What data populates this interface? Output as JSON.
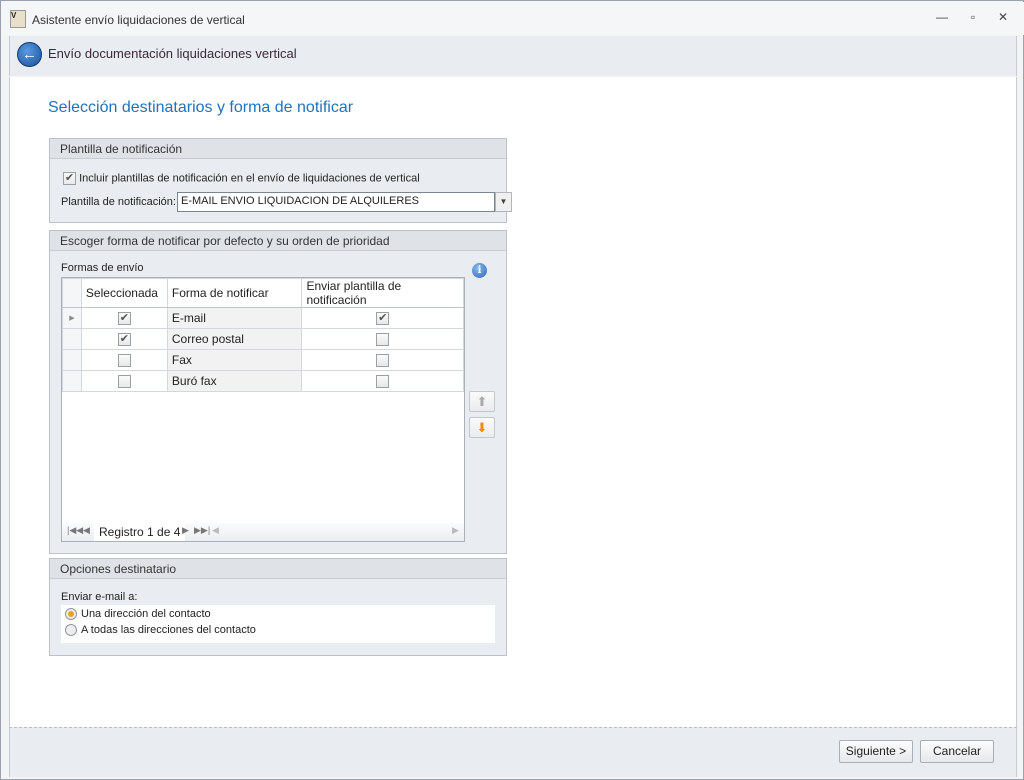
{
  "window": {
    "title": "Asistente envío liquidaciones de vertical",
    "minimize": "—",
    "restore": "▫",
    "close": "✕"
  },
  "header": {
    "title": "Envío documentación liquidaciones vertical"
  },
  "page": {
    "title": "Selección destinatarios y forma de notificar"
  },
  "plantilla": {
    "group_title": "Plantilla de notificación",
    "include_label": "Incluir plantillas de notificación en el envío de liquidaciones de vertical",
    "include_checked": true,
    "template_label": "Plantilla de notificación:",
    "template_value": "E-MAIL ENVIO LIQUIDACION DE ALQUILERES"
  },
  "formas": {
    "group_title": "Escoger forma de notificar por defecto y su orden de prioridad",
    "grid_label": "Formas de envío",
    "columns": [
      "Seleccionada",
      "Forma de notificar",
      "Enviar plantilla de notificación"
    ],
    "rows": [
      {
        "selected": true,
        "name": "E-mail",
        "send_template": true
      },
      {
        "selected": true,
        "name": "Correo postal",
        "send_template": false
      },
      {
        "selected": false,
        "name": "Fax",
        "send_template": false
      },
      {
        "selected": false,
        "name": "Buró fax",
        "send_template": false
      }
    ],
    "navigator": "Registro 1 de 4"
  },
  "destinatario": {
    "group_title": "Opciones destinatario",
    "send_label": "Enviar e-mail a:",
    "options": [
      "Una dirección del contacto",
      "A todas las direcciones del contacto"
    ],
    "selected_index": 0
  },
  "footer": {
    "next": "Siguiente >",
    "cancel": "Cancelar"
  }
}
